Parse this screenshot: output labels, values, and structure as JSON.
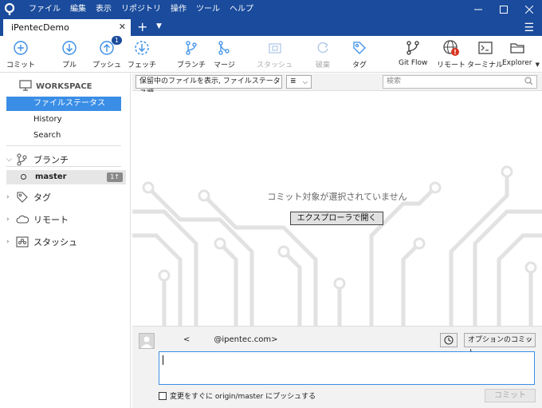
{
  "menu": [
    "ファイル",
    "編集",
    "表示",
    "リポジトリ",
    "操作",
    "ツール",
    "ヘルプ"
  ],
  "tab": {
    "title": "iPentecDemo"
  },
  "toolbar": {
    "commit": "コミット",
    "pull": "プル",
    "push": "プッシュ",
    "push_badge": "1",
    "fetch": "フェッチ",
    "branch": "ブランチ",
    "merge": "マージ",
    "stash": "スタッシュ",
    "discard": "破棄",
    "tag": "タグ",
    "gitflow": "Git Flow",
    "remote": "リモート",
    "terminal": "ターミナル",
    "explorer": "Explorer"
  },
  "sidebar": {
    "workspace": "WORKSPACE",
    "items": [
      "ファイルステータス",
      "History",
      "Search"
    ],
    "branches_label": "ブランチ",
    "branch_name": "master",
    "branch_count": "1↑",
    "tags_label": "タグ",
    "remotes_label": "リモート",
    "stash_label": "スタッシュ"
  },
  "main": {
    "filter": "保留中のファイルを表示, ファイルステータス順",
    "view": "≣",
    "search_placeholder": "検索",
    "empty_message": "コミット対象が選択されていません",
    "open_explorer": "エクスプローラで開く"
  },
  "commit": {
    "author_lt": "<",
    "author_email": "@ipentec.com>",
    "options": "オプションのコミット",
    "push_option": "変更をすぐに origin/master にプッシュする",
    "commit_button": "コミット"
  },
  "colors": {
    "titlebar": "#1a4b9c",
    "accent": "#3a8ee6",
    "art": "#e2e2e2"
  }
}
